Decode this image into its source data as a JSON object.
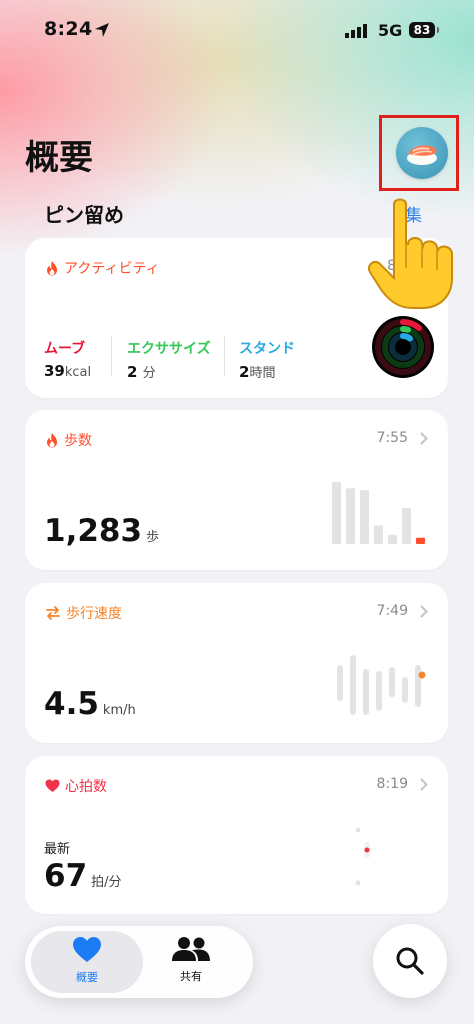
{
  "status_bar": {
    "time": "8:24",
    "network": "5G",
    "battery": "83"
  },
  "header": {
    "title": "概要",
    "avatar_icon": "sushi-avatar-icon"
  },
  "pinned": {
    "title": "ピン留め",
    "edit_label": "集"
  },
  "cards": {
    "activity": {
      "title": "アクティビティ",
      "time": "8",
      "move": {
        "label": "ムーブ",
        "value": "39",
        "unit": "kcal"
      },
      "exercise": {
        "label": "エクササイズ",
        "value": "2",
        "unit": "分"
      },
      "stand": {
        "label": "スタンド",
        "value": "2",
        "unit": "時間"
      },
      "colors": {
        "move": "#e8173a",
        "exercise": "#35c759",
        "stand": "#27a9e1"
      }
    },
    "steps": {
      "title": "歩数",
      "time": "7:55",
      "value": "1,283",
      "unit": "歩",
      "chart_data": {
        "type": "bar",
        "values": [
          60,
          54,
          52,
          18,
          9,
          35,
          6
        ],
        "highlight_last": true
      }
    },
    "walking_speed": {
      "title": "歩行速度",
      "time": "7:49",
      "value": "4.5",
      "unit": "km/h"
    },
    "heart_rate": {
      "title": "心拍数",
      "time": "8:19",
      "latest_label": "最新",
      "value": "67",
      "unit": "拍/分"
    }
  },
  "tabbar": {
    "summary_label": "概要",
    "sharing_label": "共有",
    "accent": "#1c7cf4"
  }
}
